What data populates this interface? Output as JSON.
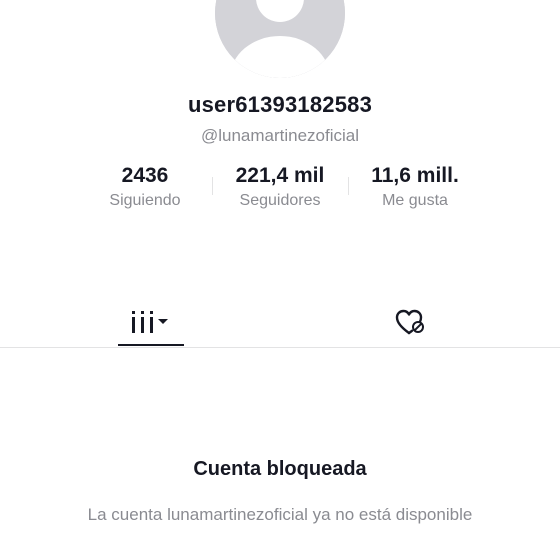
{
  "profile": {
    "username": "user61393182583",
    "handle": "@lunamartinezoficial",
    "avatar_icon": "default-avatar-icon"
  },
  "stats": {
    "following": {
      "value": "2436",
      "label": "Siguiendo"
    },
    "followers": {
      "value": "221,4 mil",
      "label": "Seguidores"
    },
    "likes": {
      "value": "11,6 mill.",
      "label": "Me gusta"
    }
  },
  "tabs": [
    {
      "name": "videos",
      "icon": "grid-dropdown-icon",
      "active": true
    },
    {
      "name": "liked",
      "icon": "heart-lock-icon",
      "active": false
    }
  ],
  "blocked": {
    "title": "Cuenta bloqueada",
    "description": "La cuenta lunamartinezoficial ya no está disponible"
  },
  "colors": {
    "text_primary": "#161823",
    "text_secondary": "#8a8b91",
    "avatar_bg": "#d3d3d8",
    "divider": "#e3e3e4"
  }
}
